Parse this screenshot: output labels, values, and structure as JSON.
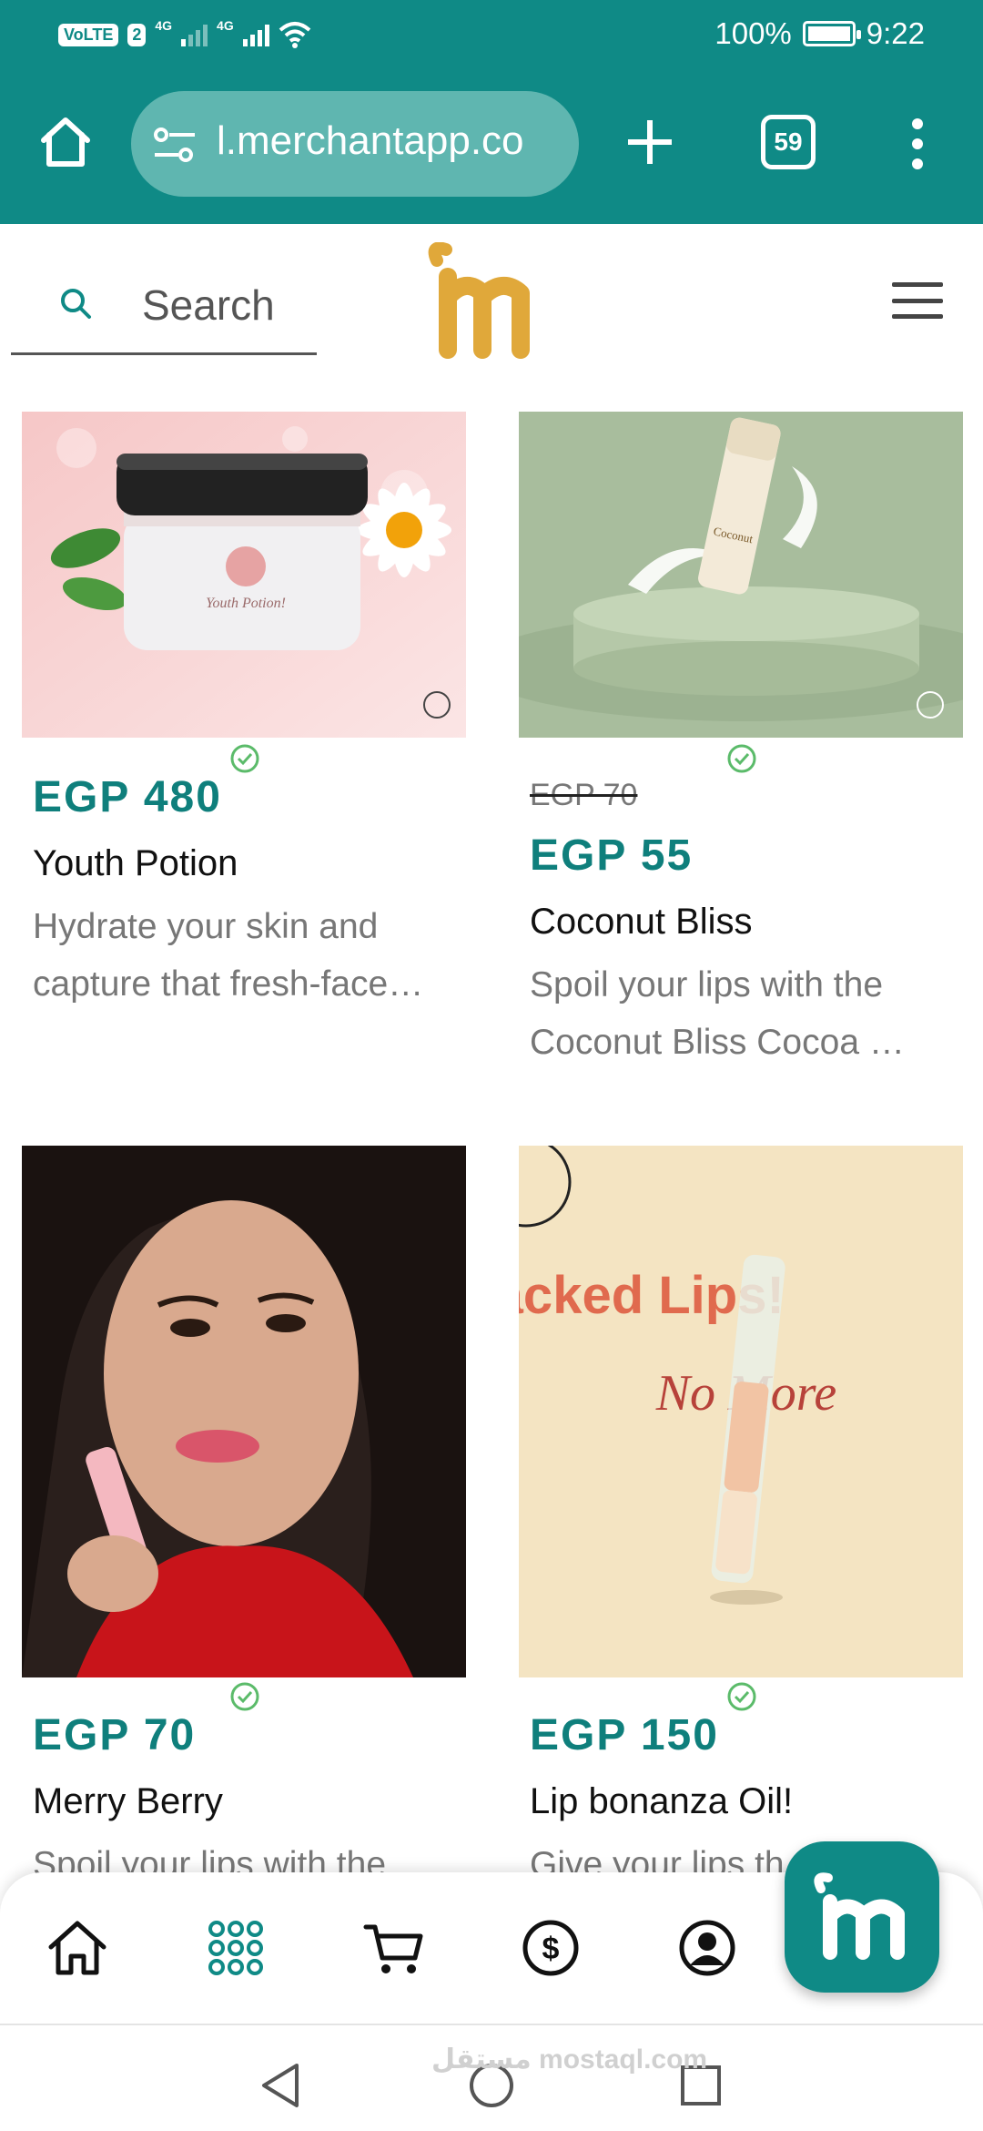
{
  "status_bar": {
    "volte": "VoLTE",
    "sim": "2",
    "net1": "4G",
    "net2": "4G",
    "battery": "100%",
    "time": "9:22"
  },
  "browser": {
    "url": "l.merchantapp.co",
    "tab_count": "59"
  },
  "site": {
    "search_label": "Search",
    "brand_color": "#e0a83a",
    "accent_color": "#0f8a86"
  },
  "products": [
    {
      "price": "EGP 480",
      "name": "Youth Potion",
      "desc": [
        "Hydrate your skin and",
        "capture that fresh-face…"
      ],
      "image": "youth-potion-jar-image"
    },
    {
      "old_price": "EGP 70",
      "price": "EGP 55",
      "name": "Coconut Bliss",
      "desc": [
        "Spoil your lips with the",
        "Coconut Bliss Cocoa …"
      ],
      "image": "coconut-bliss-balm-image"
    },
    {
      "price": "EGP 70",
      "name": "Merry Berry",
      "desc": [
        "Spoil your lips with the"
      ],
      "image": "merry-berry-model-image"
    },
    {
      "price": "EGP 150",
      "name": "Lip bonanza Oil!",
      "desc": [
        "Give your lips th"
      ],
      "image": "lip-oil-poster-image",
      "poster_line1": "Cracked Lips!",
      "poster_line2": "No More"
    }
  ],
  "bottom_nav": [
    "home-icon",
    "grid-icon",
    "cart-icon",
    "dollar-icon",
    "account-icon"
  ],
  "watermark": "مستقل mostaql.com"
}
